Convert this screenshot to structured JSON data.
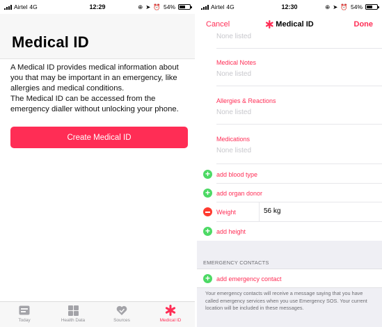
{
  "left_screen": {
    "status": {
      "carrier": "Airtel",
      "network": "4G",
      "time": "12:29",
      "battery": "54%"
    },
    "title": "Medical ID",
    "description_1": "A Medical ID provides medical information about you that may be important in an emergency, like allergies and medical conditions.",
    "description_2": "The Medical ID can be accessed from the emergency dialler without unlocking your phone.",
    "create_button": "Create Medical ID",
    "tabs": [
      {
        "label": "Today",
        "icon": "calendar-icon",
        "active": false
      },
      {
        "label": "Health Data",
        "icon": "grid-icon",
        "active": false
      },
      {
        "label": "Sources",
        "icon": "heart-icon",
        "active": false
      },
      {
        "label": "Medical ID",
        "icon": "asterisk-icon",
        "active": true
      }
    ]
  },
  "right_screen": {
    "status": {
      "carrier": "Airtel",
      "network": "4G",
      "time": "12:30",
      "battery": "54%"
    },
    "nav": {
      "cancel": "Cancel",
      "title": "Medical ID",
      "done": "Done"
    },
    "top_value": "None listed",
    "fields": [
      {
        "label": "Medical Notes",
        "value": "None listed"
      },
      {
        "label": "Allergies & Reactions",
        "value": "None listed"
      },
      {
        "label": "Medications",
        "value": "None listed"
      }
    ],
    "add_blood_type": "add blood type",
    "add_organ_donor": "add organ donor",
    "weight_label": "Weight",
    "weight_value": "56 kg",
    "add_height": "add height",
    "emergency_header": "EMERGENCY CONTACTS",
    "add_emergency_contact": "add emergency contact",
    "footer_note": "Your emergency contacts will receive a message saying that you have called emergency services when you use Emergency SOS. Your current location will be included in these messages.",
    "accent_color": "#ff2d55"
  }
}
